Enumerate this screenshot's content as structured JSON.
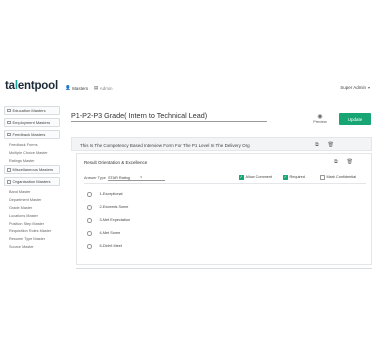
{
  "topbar": {
    "logo_dark_1": "ta",
    "logo_teal": "l",
    "logo_dark_2": "entpool",
    "nav": [
      {
        "icon": "person-icon",
        "glyph": "👤",
        "label": "Masters"
      },
      {
        "icon": "admin-icon",
        "glyph": "▤",
        "label": "Admin"
      }
    ],
    "user": {
      "name": "Super Admin",
      "chevron": "▾"
    }
  },
  "sidebar": {
    "groups": [
      {
        "label": "Education Masters",
        "items": []
      },
      {
        "label": "Employment Masters",
        "items": []
      },
      {
        "label": "Feedback Masters",
        "items": [
          "Feedback Forms",
          "Multiple Choice Master",
          "Ratings Master"
        ]
      },
      {
        "label": "Miscellaneous Masters",
        "items": []
      },
      {
        "label": "Organisation Masters",
        "items": [
          "Band Master",
          "Department Master",
          "Grade Master",
          "Locations Master",
          "Position Step Master",
          "Requisition Roles Master",
          "Resume Type Master",
          "Source Master"
        ]
      }
    ]
  },
  "header": {
    "title": "P1-P2-P3 Grade( Intern to Technical Lead)",
    "preview_label": "Preview",
    "update_label": "Update"
  },
  "form": {
    "description": "This Is The Competency Based Interview Form For The P1 Level In The Delivery Org",
    "section": {
      "title": "Result Orientation & Excellence",
      "answer_type_label": "Answer Type",
      "answer_type_value": "STAR Rating",
      "checks": [
        {
          "label": "Allow Comment",
          "checked": true
        },
        {
          "label": "Required",
          "checked": true
        },
        {
          "label": "Mark Confidential",
          "checked": false
        }
      ],
      "options": [
        "1-Exceptional",
        "2-Exceeds Some",
        "3-Met Expectation",
        "4-Met Some",
        "5-Didn't Meet"
      ]
    }
  },
  "colors": {
    "accent": "#17a673",
    "logo_teal": "#17a39a",
    "logo_dark": "#1c2b39"
  }
}
